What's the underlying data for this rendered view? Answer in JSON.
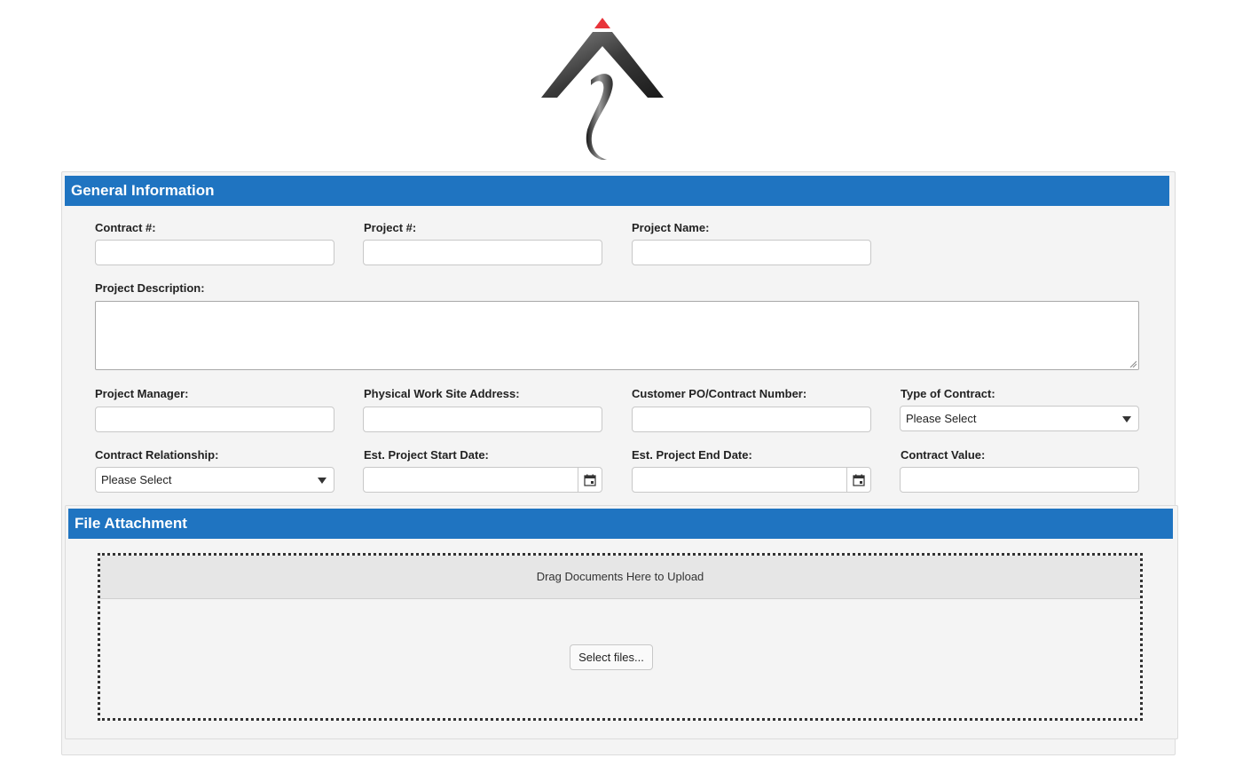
{
  "logo": {
    "icon": "company-logo-arrow-icon",
    "accent_color": "#e8343a"
  },
  "sections": {
    "general_title": "General Information",
    "file_title": "File Attachment",
    "header_color": "#1f74c1"
  },
  "fields": {
    "contract_no": {
      "label": "Contract #:",
      "value": ""
    },
    "project_no": {
      "label": "Project #:",
      "value": ""
    },
    "project_name": {
      "label": "Project Name:",
      "value": ""
    },
    "project_description": {
      "label": "Project Description:",
      "value": ""
    },
    "project_manager": {
      "label": "Project Manager:",
      "value": ""
    },
    "work_site_address": {
      "label": "Physical Work Site Address:",
      "value": ""
    },
    "customer_po": {
      "label": "Customer PO/Contract Number:",
      "value": ""
    },
    "type_of_contract": {
      "label": "Type of Contract:",
      "selected": "Please Select"
    },
    "contract_relationship": {
      "label": "Contract Relationship:",
      "selected": "Please Select"
    },
    "start_date": {
      "label": "Est. Project Start Date:",
      "value": "",
      "icon": "calendar-icon"
    },
    "end_date": {
      "label": "Est. Project End Date:",
      "value": "",
      "icon": "calendar-icon"
    },
    "contract_value": {
      "label": "Contract Value:",
      "value": ""
    }
  },
  "upload": {
    "drop_text": "Drag Documents Here to Upload",
    "select_button": "Select files..."
  }
}
